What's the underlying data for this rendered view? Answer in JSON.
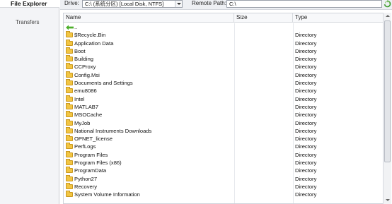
{
  "nav": {
    "file_explorer": "File Explorer",
    "transfers": "Transfers"
  },
  "toolbar": {
    "drive_label": "Drive:",
    "drive_value": "C:\\ (系统分区) [Local Disk, NTFS]",
    "remote_label": "Remote Path:",
    "remote_value": "C:\\",
    "refresh_icon": "refresh-icon"
  },
  "columns": {
    "name": "Name",
    "size": "Size",
    "type": "Type"
  },
  "rows": [
    {
      "name": "..",
      "type": "",
      "icon": "up-arrow-icon"
    },
    {
      "name": "$Recycle.Bin",
      "type": "Directory",
      "icon": "folder-icon"
    },
    {
      "name": "Application Data",
      "type": "Directory",
      "icon": "folder-icon"
    },
    {
      "name": "Boot",
      "type": "Directory",
      "icon": "folder-icon"
    },
    {
      "name": "Building",
      "type": "Directory",
      "icon": "folder-icon"
    },
    {
      "name": "CCProxy",
      "type": "Directory",
      "icon": "folder-icon"
    },
    {
      "name": "Config.Msi",
      "type": "Directory",
      "icon": "folder-icon"
    },
    {
      "name": "Documents and Settings",
      "type": "Directory",
      "icon": "folder-icon"
    },
    {
      "name": "emu8086",
      "type": "Directory",
      "icon": "folder-icon"
    },
    {
      "name": "Intel",
      "type": "Directory",
      "icon": "folder-icon"
    },
    {
      "name": "MATLAB7",
      "type": "Directory",
      "icon": "folder-icon"
    },
    {
      "name": "MSOCache",
      "type": "Directory",
      "icon": "folder-icon"
    },
    {
      "name": "MyJob",
      "type": "Directory",
      "icon": "folder-icon"
    },
    {
      "name": "National Instruments Downloads",
      "type": "Directory",
      "icon": "folder-icon"
    },
    {
      "name": "OPNET_license",
      "type": "Directory",
      "icon": "folder-icon"
    },
    {
      "name": "PerfLogs",
      "type": "Directory",
      "icon": "folder-icon"
    },
    {
      "name": "Program Files",
      "type": "Directory",
      "icon": "folder-icon"
    },
    {
      "name": "Program Files (x86)",
      "type": "Directory",
      "icon": "folder-icon"
    },
    {
      "name": "ProgramData",
      "type": "Directory",
      "icon": "folder-icon"
    },
    {
      "name": "Python27",
      "type": "Directory",
      "icon": "folder-icon"
    },
    {
      "name": "Recovery",
      "type": "Directory",
      "icon": "folder-icon"
    },
    {
      "name": "System Volume Information",
      "type": "Directory",
      "icon": "folder-icon"
    }
  ],
  "colors": {
    "folder": "#f2c542",
    "up_arrow": "#4caf2a",
    "refresh": "#3f9b2f"
  }
}
